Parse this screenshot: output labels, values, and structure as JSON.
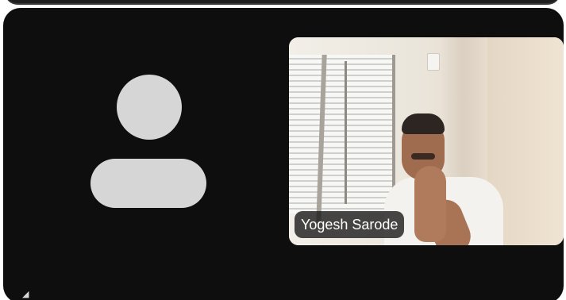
{
  "call": {
    "remote_participant": {
      "video": "off",
      "avatar_icon": "person-placeholder-icon"
    },
    "self_view": {
      "name": "Yogesh Sarode"
    }
  },
  "colors": {
    "tile_background": "#0e0e0e",
    "avatar_placeholder": "#d6d6d6",
    "name_tag_background": "#141414"
  }
}
